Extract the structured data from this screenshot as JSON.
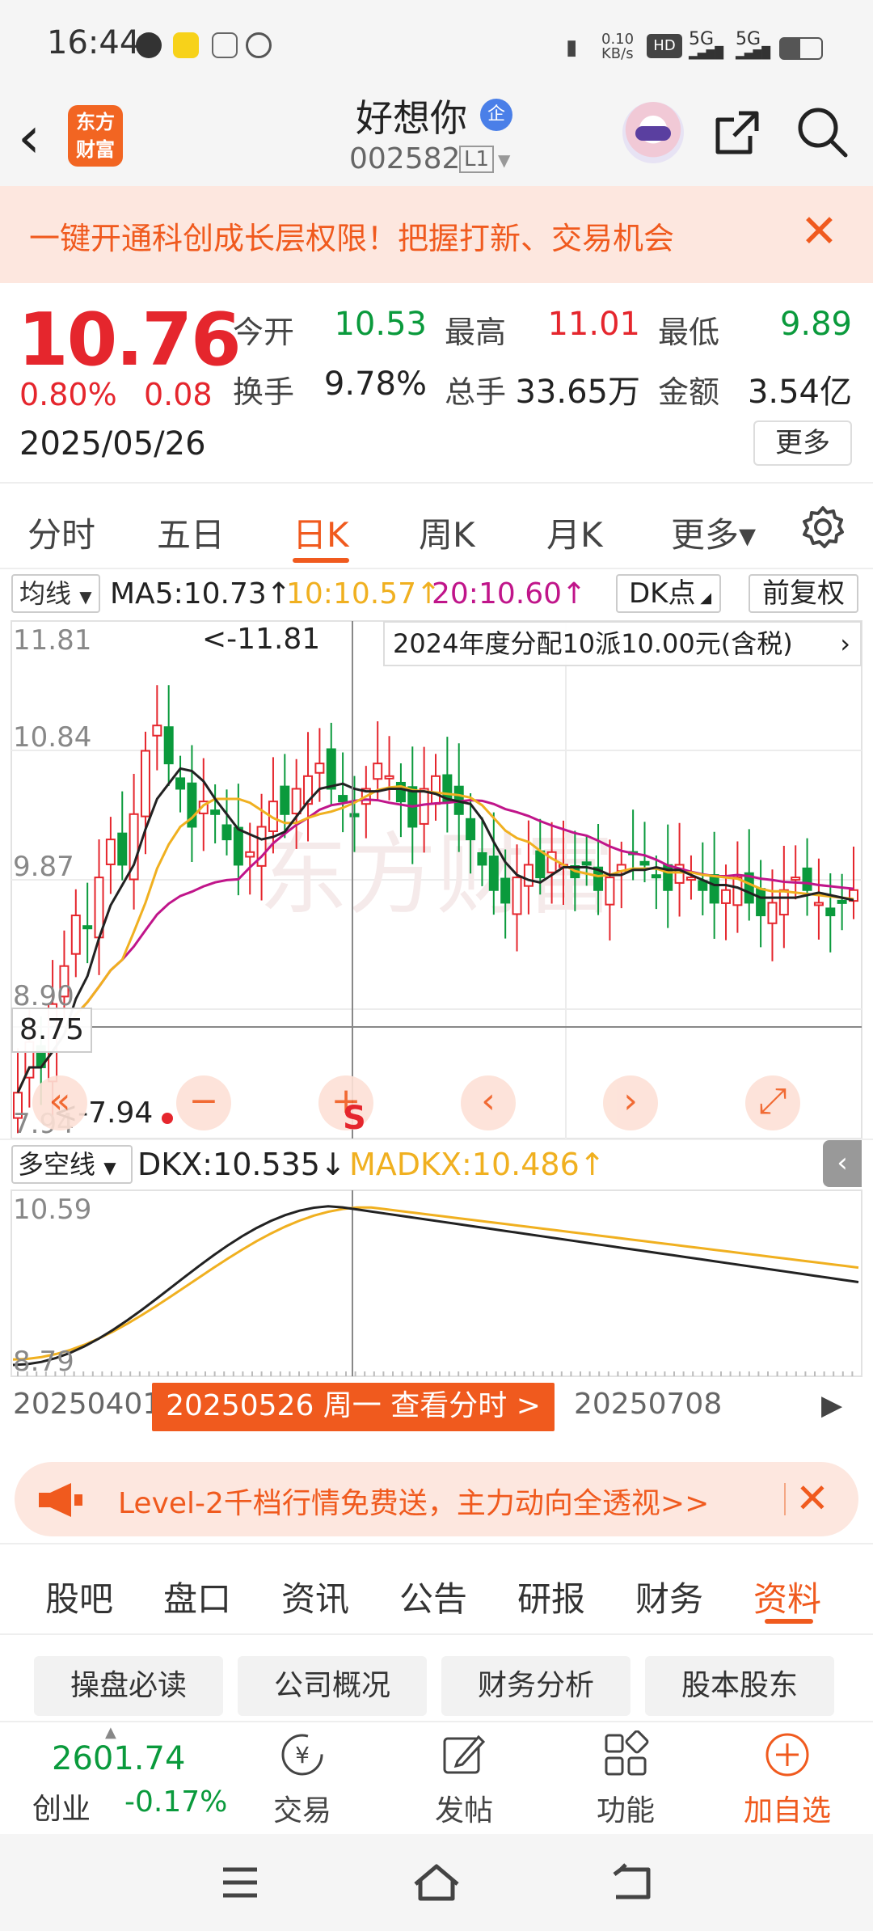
{
  "status_bar": {
    "time": "16:44",
    "net_speed": "0.10 KB/s",
    "signal1": "5G",
    "signal2": "5G"
  },
  "header": {
    "logo": "东方财富",
    "stock_name": "好想你",
    "badge": "企",
    "code": "002582",
    "level": "L1"
  },
  "promo": {
    "text": "一键开通科创成长层权限！把握打新、交易机会"
  },
  "quote": {
    "price": "10.76",
    "change_pct": "0.80%",
    "change_amt": "0.08",
    "date": "2025/05/26",
    "open_label": "今开",
    "open": "10.53",
    "high_label": "最高",
    "high": "11.01",
    "low_label": "最低",
    "low": "9.89",
    "turnover_label": "换手",
    "turnover": "9.78%",
    "volume_label": "总手",
    "volume": "33.65万",
    "amount_label": "金额",
    "amount": "3.54亿",
    "more": "更多"
  },
  "period_tabs": [
    "分时",
    "五日",
    "日K",
    "周K",
    "月K",
    "更多▾"
  ],
  "active_period": "日K",
  "ma_bar": {
    "selector": "均线",
    "ma5": "MA5:10.73↑",
    "ma10": "10:10.57↑",
    "ma20": "20:10.60↑",
    "dk_point": "DK点",
    "adjust": "前复权"
  },
  "kline": {
    "dividend_note": "2024年度分配10派10.00元(含税)",
    "y_labels": [
      "11.81",
      "10.84",
      "9.87",
      "8.90",
      "7.94"
    ],
    "high_marker": "<-11.81",
    "low_marker": "<-7.94",
    "cursor_price": "8.75",
    "sell_mark": "S",
    "watermark": "东方财富",
    "controls": [
      "«",
      "−",
      "+",
      "‹",
      "›",
      "⤢"
    ]
  },
  "indicator": {
    "selector": "多空线",
    "dkx": "DKX:10.535↓",
    "madkx": "MADKX:10.486↑",
    "y_top": "10.59",
    "y_bottom": "8.79"
  },
  "date_axis": {
    "start": "20250401",
    "mid": "20250708",
    "cursor_pill": "20250526 周一 查看分时 >"
  },
  "level2_banner": {
    "text": "Level-2千档行情免费送，主力动向全透视>>"
  },
  "section_tabs": [
    "股吧",
    "盘口",
    "资讯",
    "公告",
    "研报",
    "财务",
    "资料"
  ],
  "active_section": "资料",
  "chips": [
    "操盘必读",
    "公司概况",
    "财务分析",
    "股本股东"
  ],
  "toolbar": {
    "index_value": "2601.74",
    "index_name": "创业",
    "index_change": "-0.17%",
    "trade": "交易",
    "post": "发帖",
    "func": "功能",
    "add": "加自选"
  },
  "colors": {
    "up": "#e5262d",
    "down": "#0a9a3c",
    "accent": "#f05a1e",
    "ma10": "#f0b020",
    "ma20": "#c0158a"
  }
}
